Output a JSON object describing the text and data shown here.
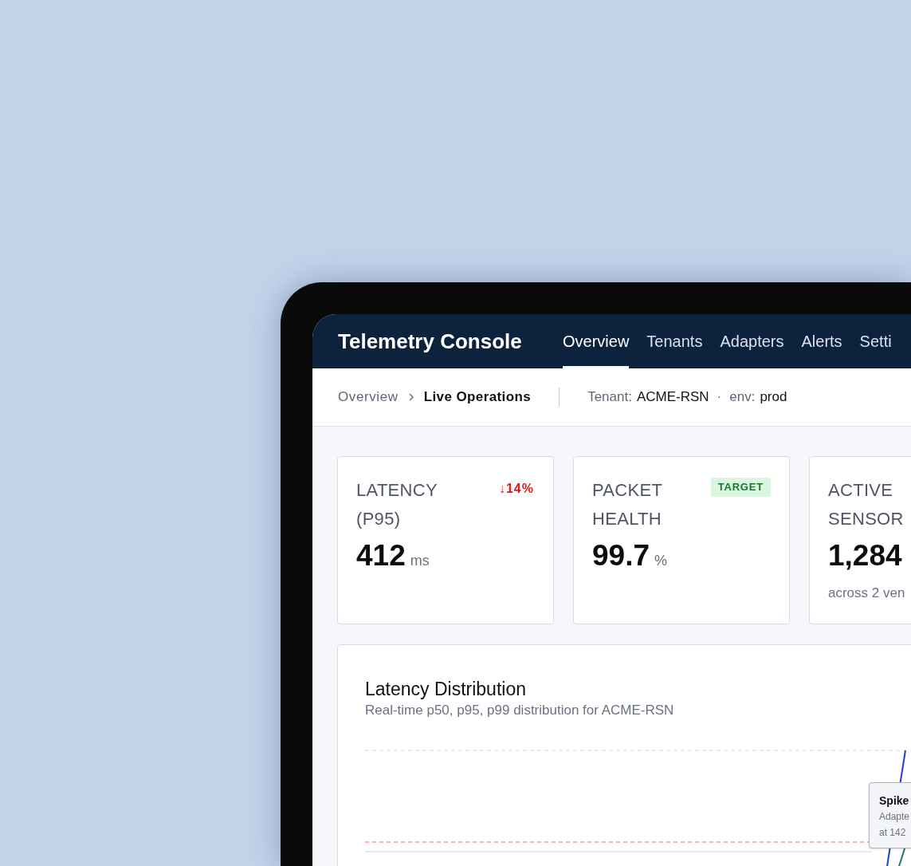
{
  "app": {
    "title": "Telemetry Console"
  },
  "nav": [
    {
      "label": "Overview",
      "selected": true
    },
    {
      "label": "Tenants",
      "selected": false
    },
    {
      "label": "Adapters",
      "selected": false
    },
    {
      "label": "Alerts",
      "selected": false
    },
    {
      "label": "Setti",
      "selected": false
    }
  ],
  "breadcrumb": [
    {
      "label": "Overview",
      "current": false
    },
    {
      "label": "Live Operations",
      "current": true
    }
  ],
  "context": [
    {
      "key": "Tenant:",
      "value": "ACME-RSN"
    },
    {
      "key": "env:",
      "value": "prod"
    }
  ],
  "context_separator": "·",
  "metrics": [
    {
      "label": "LATENCY (P95)",
      "value": "412",
      "unit": "ms",
      "badge": {
        "kind": "delta",
        "text": "↓14%"
      }
    },
    {
      "label": "PACKET HEALTH",
      "value": "99.7",
      "unit": "%",
      "badge": {
        "kind": "status",
        "text": "TARGET"
      }
    },
    {
      "label": "ACTIVE SENSOR",
      "value": "1,284",
      "note": "across 2 ven"
    }
  ],
  "chart": {
    "title": "Latency Distribution",
    "subtitle": "Real-time p50, p95, p99 distribution for ACME-RSN",
    "tooltip": {
      "title": "Spike",
      "lines": [
        "Adapte",
        "at 142"
      ]
    }
  }
}
